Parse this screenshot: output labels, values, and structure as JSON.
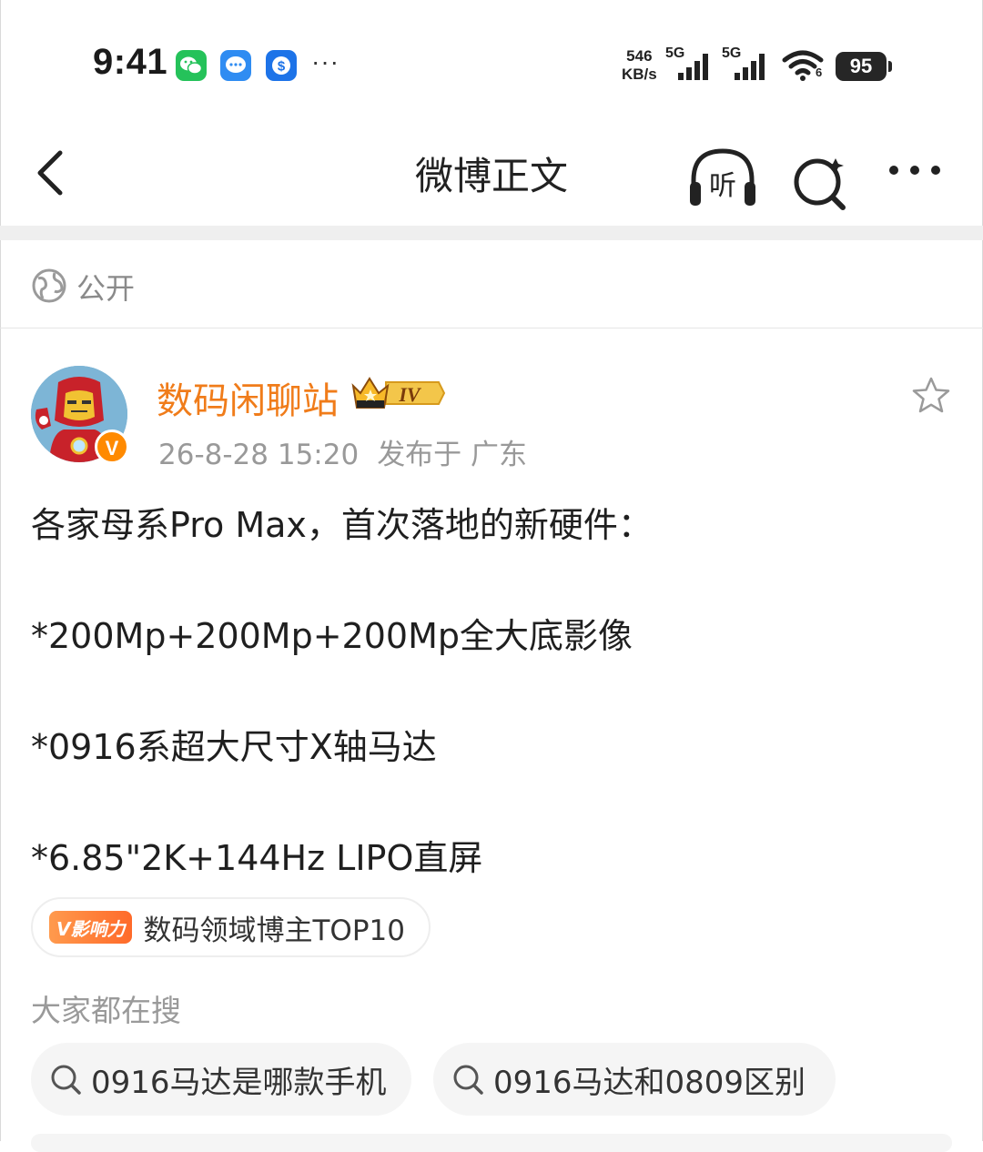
{
  "status_bar": {
    "time": "9:41",
    "notifications": [
      "wechat-icon",
      "messages-icon",
      "wallet-icon"
    ],
    "more": "···",
    "net_speed_value": "546",
    "net_speed_unit": "KB/s",
    "sim1_label": "5G",
    "sim2_label": "5G",
    "wifi_badge": "6",
    "battery": "95"
  },
  "nav": {
    "title": "微博正文",
    "listen_label": "听"
  },
  "visibility": {
    "label": "公开"
  },
  "post": {
    "username": "数码闲聊站",
    "rank_badge": "IV",
    "verified_badge": "V",
    "timestamp": "26-8-28 15:20",
    "location": "发布于 广东",
    "lines": [
      "各家母系Pro Max，首次落地的新硬件：",
      "*200Mp+200Mp+200Mp全大底影像",
      "*0916系超大尺寸X轴马达",
      "*6.85\"2K+144Hz LIPO直屏"
    ],
    "influence_tag": "V影响力",
    "influence_text": "数码领域博主TOP10"
  },
  "hot_search": {
    "title": "大家都在搜",
    "chips": [
      "0916马达是哪款手机",
      "0916马达和0809区别"
    ]
  },
  "colors": {
    "username": "#f07c1a",
    "verified": "#ff8a00",
    "chip_bg": "#f5f5f5"
  }
}
